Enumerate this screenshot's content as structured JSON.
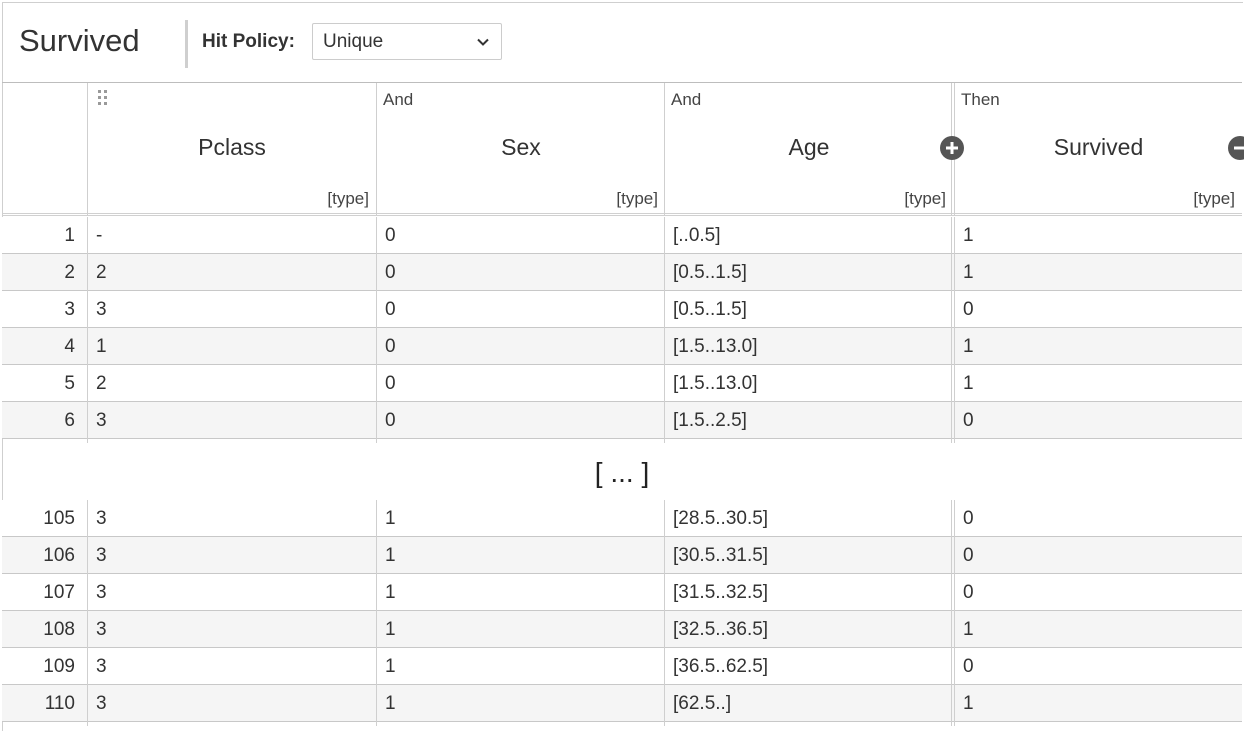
{
  "decision_table": {
    "name": "Survived",
    "hit_policy_label": "Hit Policy:",
    "hit_policy_value": "Unique"
  },
  "columns": [
    {
      "kind": "",
      "title": "Pclass",
      "type": "[type]"
    },
    {
      "kind": "And",
      "title": "Sex",
      "type": "[type]"
    },
    {
      "kind": "And",
      "title": "Age",
      "type": "[type]"
    },
    {
      "kind": "Then",
      "title": "Survived",
      "type": "[type]"
    }
  ],
  "ellipsis": "[ ... ]",
  "rows_top": [
    {
      "n": "1",
      "pclass": "-",
      "sex": "0",
      "age": "[..0.5]",
      "survived": "1"
    },
    {
      "n": "2",
      "pclass": "2",
      "sex": "0",
      "age": "[0.5..1.5]",
      "survived": "1"
    },
    {
      "n": "3",
      "pclass": "3",
      "sex": "0",
      "age": "[0.5..1.5]",
      "survived": "0"
    },
    {
      "n": "4",
      "pclass": "1",
      "sex": "0",
      "age": "[1.5..13.0]",
      "survived": "1"
    },
    {
      "n": "5",
      "pclass": "2",
      "sex": "0",
      "age": "[1.5..13.0]",
      "survived": "1"
    },
    {
      "n": "6",
      "pclass": "3",
      "sex": "0",
      "age": "[1.5..2.5]",
      "survived": "0"
    }
  ],
  "rows_bottom": [
    {
      "n": "105",
      "pclass": "3",
      "sex": "1",
      "age": "[28.5..30.5]",
      "survived": "0"
    },
    {
      "n": "106",
      "pclass": "3",
      "sex": "1",
      "age": "[30.5..31.5]",
      "survived": "0"
    },
    {
      "n": "107",
      "pclass": "3",
      "sex": "1",
      "age": "[31.5..32.5]",
      "survived": "0"
    },
    {
      "n": "108",
      "pclass": "3",
      "sex": "1",
      "age": "[32.5..36.5]",
      "survived": "1"
    },
    {
      "n": "109",
      "pclass": "3",
      "sex": "1",
      "age": "[36.5..62.5]",
      "survived": "0"
    },
    {
      "n": "110",
      "pclass": "3",
      "sex": "1",
      "age": "[62.5..]",
      "survived": "1"
    }
  ],
  "icons": {
    "drag": "drag-handle-icon",
    "add": "add-column-icon",
    "select": "chevron-down-icon"
  }
}
